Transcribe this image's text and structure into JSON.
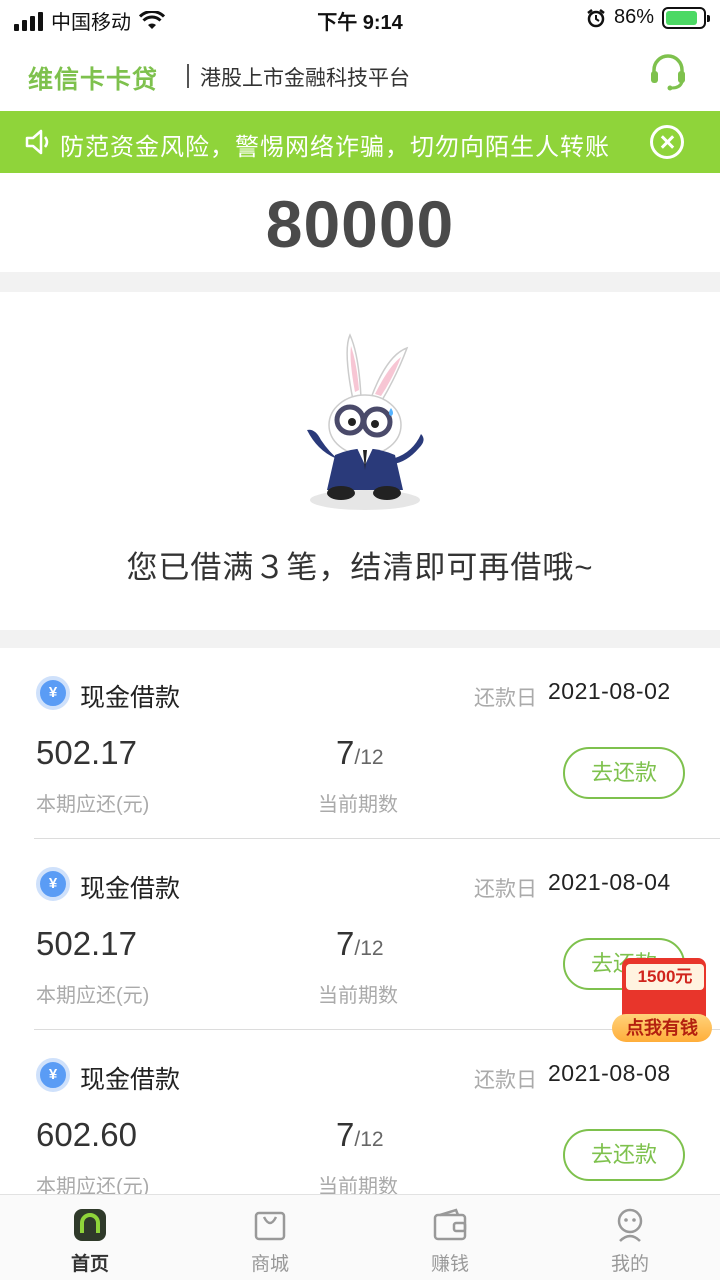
{
  "status_bar": {
    "carrier": "中国移动",
    "time": "下午 9:14",
    "battery_percent": "86%",
    "battery_level": 0.86
  },
  "header": {
    "brand": "维信卡卡贷",
    "subtitle": "港股上市金融科技平台",
    "service_icon": "headset-icon"
  },
  "notice": {
    "text": "防范资金风险，警惕网络诈骗，切勿向陌生人转账"
  },
  "credit": {
    "amount": "80000"
  },
  "limit_message": "您已借满３笔，结清即可再借哦~",
  "loans": [
    {
      "title": "现金借款",
      "due_label": "还款日",
      "due_date": "2021-08-02",
      "amount": "502.17",
      "amount_label": "本期应还(元)",
      "term_current": "7",
      "term_total": "/12",
      "term_label": "当前期数",
      "button": "去还款"
    },
    {
      "title": "现金借款",
      "due_label": "还款日",
      "due_date": "2021-08-04",
      "amount": "502.17",
      "amount_label": "本期应还(元)",
      "term_current": "7",
      "term_total": "/12",
      "term_label": "当前期数",
      "button": "去还款"
    },
    {
      "title": "现金借款",
      "due_label": "还款日",
      "due_date": "2021-08-08",
      "amount": "602.60",
      "amount_label": "本期应还(元)",
      "term_current": "7",
      "term_total": "/12",
      "term_label": "当前期数",
      "button": "去还款"
    }
  ],
  "red_packet": {
    "amount": "1500元",
    "cta": "点我有钱"
  },
  "tabs": [
    {
      "label": "首页",
      "icon": "home-icon",
      "active": true
    },
    {
      "label": "商城",
      "icon": "shopping-bag-icon",
      "active": false
    },
    {
      "label": "赚钱",
      "icon": "wallet-icon",
      "active": false
    },
    {
      "label": "我的",
      "icon": "profile-icon",
      "active": false
    }
  ],
  "colors": {
    "brand_green": "#7ec14d",
    "notice_green": "#8fd43a",
    "yen_blue": "#5a9cf5",
    "red_packet": "#e8352b"
  }
}
